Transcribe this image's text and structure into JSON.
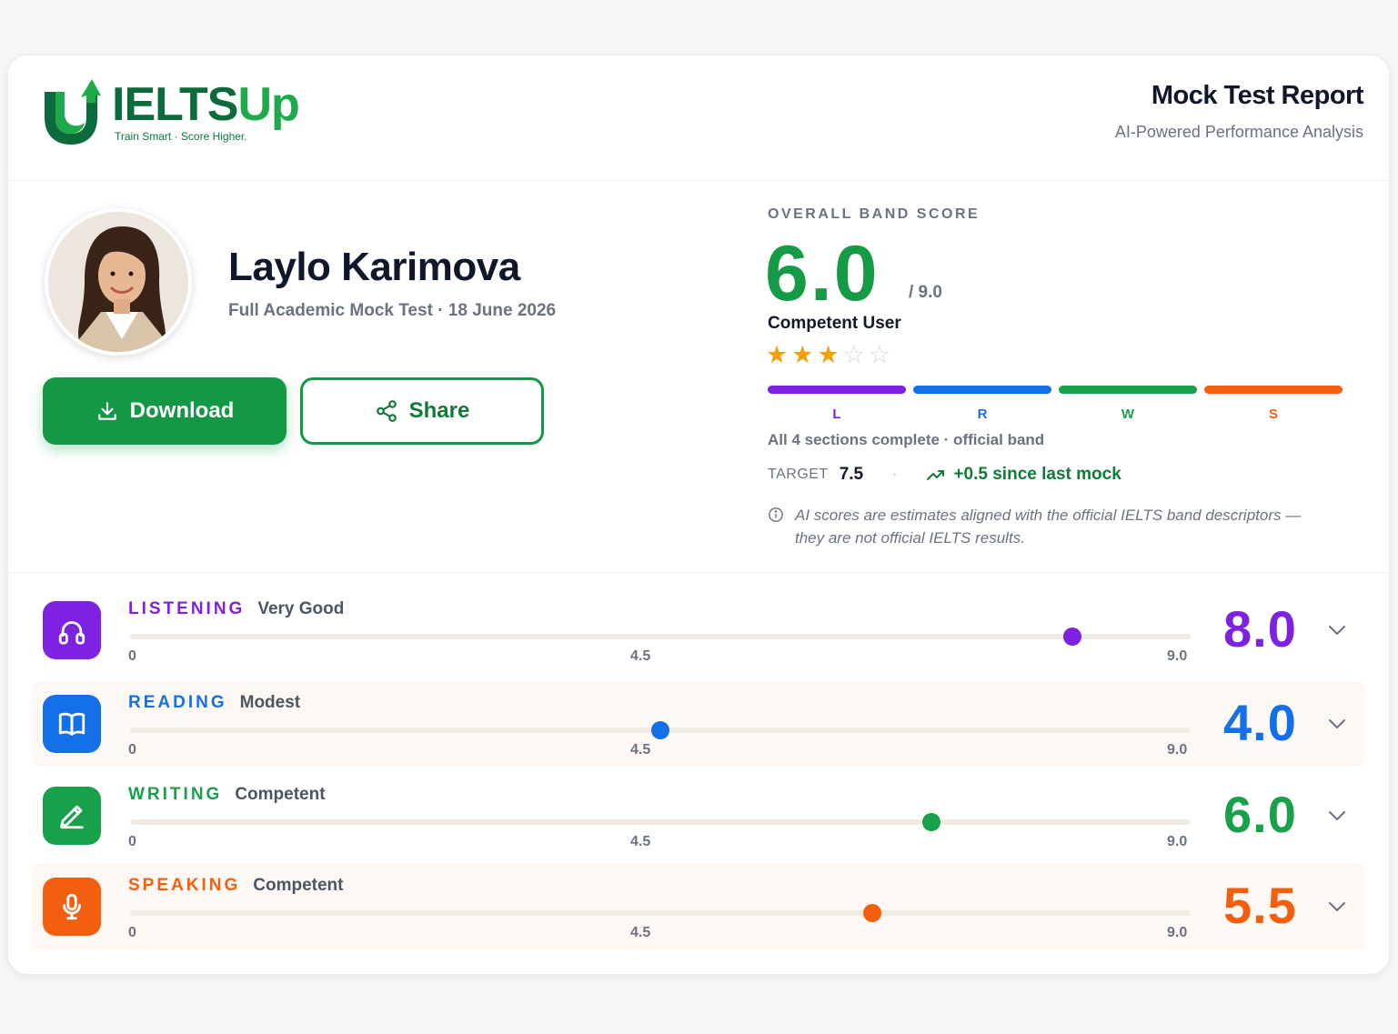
{
  "brand": {
    "name_part1": "IELTS",
    "name_part2": "Up",
    "tagline": "Train Smart · Score Higher."
  },
  "report": {
    "title": "Mock Test Report",
    "subtitle": "AI-Powered Performance Analysis"
  },
  "student": {
    "name": "Laylo Karimova",
    "meta": "Full Academic Mock Test · 18 June 2026"
  },
  "actions": {
    "download_label": "Download",
    "share_label": "Share"
  },
  "overall": {
    "label": "OVERALL BAND SCORE",
    "score": "6.0",
    "max": "/ 9.0",
    "level": "Competent User",
    "stars_filled": 3,
    "stars_total": 5,
    "sections": [
      {
        "letter": "L",
        "color": "#7c22e0"
      },
      {
        "letter": "R",
        "color": "#1470e8"
      },
      {
        "letter": "W",
        "color": "#18a04a"
      },
      {
        "letter": "S",
        "color": "#f2600f"
      }
    ],
    "sections_note": "All 4 sections complete · official band",
    "target_label": "TARGET",
    "target_value": "7.5",
    "separator": "·",
    "trend": "+0.5 since last mock",
    "disclaimer": "AI scores are estimates aligned with the official IELTS band descriptors — they are not official IELTS results."
  },
  "scale": {
    "min_label": "0",
    "mid_label": "4.5",
    "max_label": "9.0",
    "max": 9
  },
  "skills": [
    {
      "name": "LISTENING",
      "level": "Very Good",
      "score": "8.0",
      "value": 8.0,
      "color": "#7c22e0",
      "icon": "headphones-icon"
    },
    {
      "name": "READING",
      "level": "Modest",
      "score": "4.0",
      "value": 4.5,
      "color": "#1470e8",
      "icon": "book-icon"
    },
    {
      "name": "WRITING",
      "level": "Competent",
      "score": "6.0",
      "value": 6.8,
      "color": "#18a04a",
      "icon": "pen-icon"
    },
    {
      "name": "SPEAKING",
      "level": "Competent",
      "score": "5.5",
      "value": 6.3,
      "color": "#f2600f",
      "icon": "microphone-icon"
    }
  ]
}
